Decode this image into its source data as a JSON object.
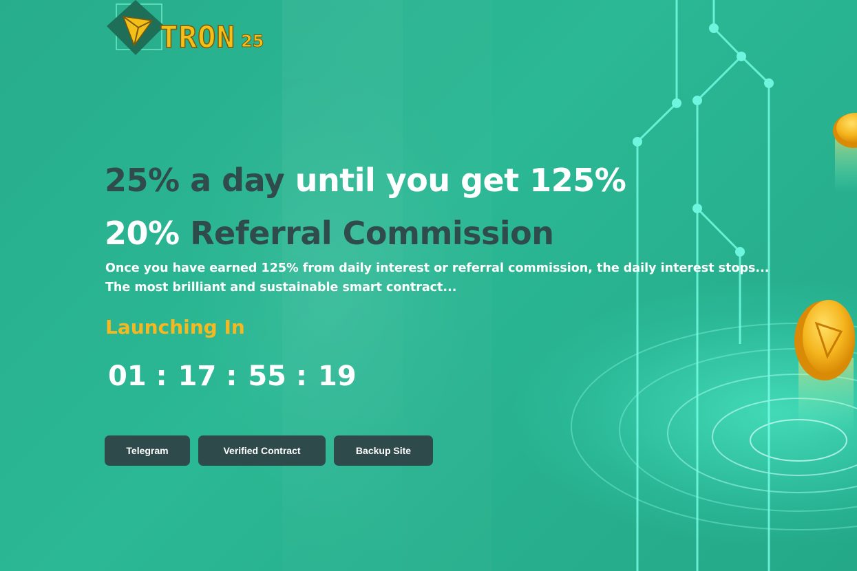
{
  "logo": {
    "text": "TRON",
    "number": "25"
  },
  "headline_line1": {
    "dark": "25% a day",
    "white": "until you get 125%"
  },
  "headline_line2": {
    "white": "20%",
    "dark": "Referral Commission"
  },
  "description": [
    "Once you have earned 125% from daily interest or referral commission, the daily interest stops...",
    "The most brilliant and sustainable smart contract..."
  ],
  "launch_label": "Launching In",
  "countdown": {
    "days": "01",
    "hours": "17",
    "minutes": "55",
    "seconds": "19",
    "separator": ":"
  },
  "buttons": {
    "telegram": "Telegram",
    "contract": "Verified Contract",
    "backup": "Backup Site"
  },
  "colors": {
    "accent": "#f5b820",
    "dark_text": "#2f4b4b",
    "button_bg": "#2f4a4a",
    "background": "#2bb894"
  }
}
